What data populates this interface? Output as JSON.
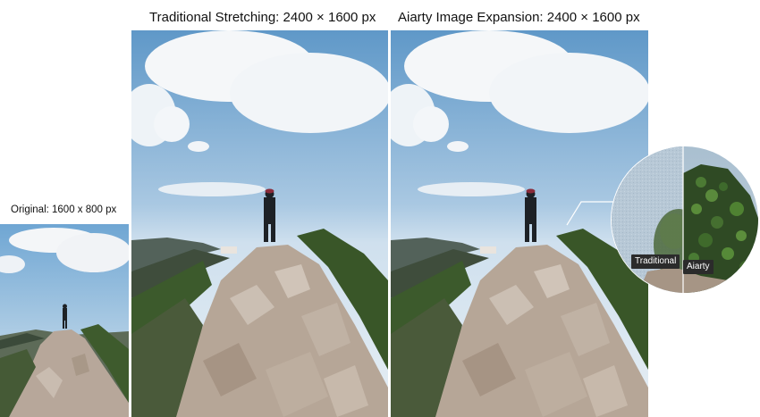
{
  "captions": {
    "original": "Original: 1600 x 800 px",
    "traditional": "Traditional Stretching: 2400 × 1600 px",
    "aiarty": "Aiarty Image Expansion: 2400 × 1600 px"
  },
  "zoom": {
    "label_left": "Traditional",
    "label_right": "Aiarty"
  },
  "colors": {
    "sky_top": "#6fa6d3",
    "sky_bottom": "#e3edf4",
    "rock": "#b8a898",
    "foliage": "#3c5a2c"
  }
}
